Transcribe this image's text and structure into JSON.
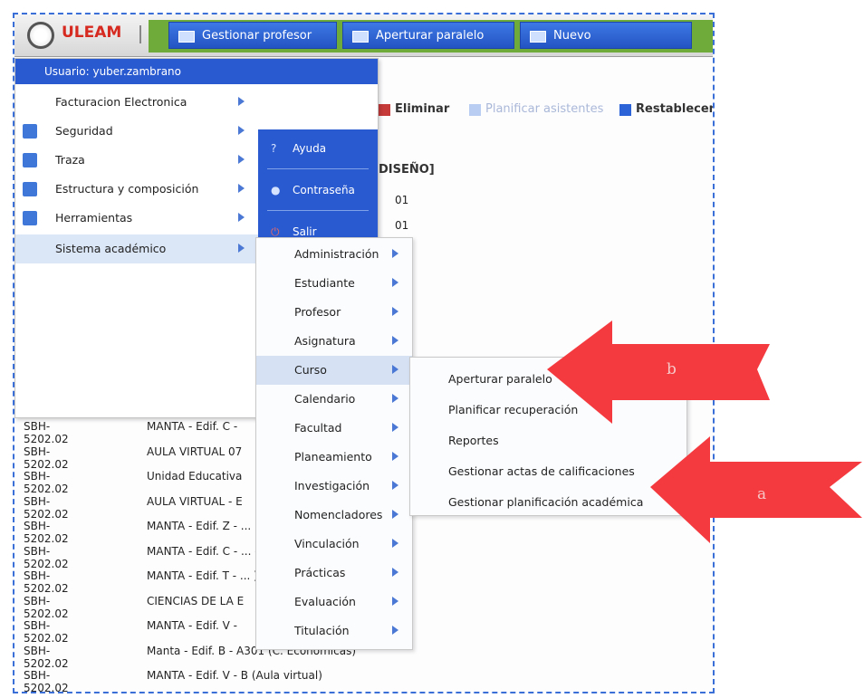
{
  "header": {
    "brand": "ULEAM",
    "nav": [
      "Gestionar profesor",
      "Aperturar paralelo",
      "Nuevo"
    ]
  },
  "toolbar": {
    "delete": "Eliminar",
    "disabled": "Planificar asistentes",
    "restore": "Restablecer"
  },
  "background": {
    "title": "DISEÑO]",
    "mini_rows": [
      "01",
      "01"
    ],
    "rows": [
      {
        "code": "SBH-5202.02",
        "place": "MANTA - Edif. C -"
      },
      {
        "code": "SBH-5202.02",
        "place": "AULA VIRTUAL 07"
      },
      {
        "code": "SBH-5202.02",
        "place": "Unidad Educativa"
      },
      {
        "code": "SBH-5202.02",
        "place": "AULA VIRTUAL - E"
      },
      {
        "code": "SBH-5202.02",
        "place": "MANTA - Edif. Z - ... la Educación)"
      },
      {
        "code": "SBH-5202.02",
        "place": "MANTA - Edif. C - ... conómicas)"
      },
      {
        "code": "SBH-5202.02",
        "place": "MANTA - Edif. T - ... )"
      },
      {
        "code": "SBH-5202.02",
        "place": "CIENCIAS DE LA E"
      },
      {
        "code": "SBH-5202.02",
        "place": "MANTA - Edif. V -"
      },
      {
        "code": "SBH-5202.02",
        "place": "Manta - Edif. B - A301 (C. Económicas)"
      },
      {
        "code": "SBH-5202.02",
        "place": "MANTA - Edif. V - B (Aula virtual)"
      }
    ]
  },
  "user_menu": {
    "user": "Usuario: yuber.zambrano",
    "items": [
      "Facturacion Electronica",
      "Seguridad",
      "Traza",
      "Estructura y composición",
      "Herramientas",
      "Sistema académico"
    ],
    "side": [
      "Ayuda",
      "Contraseña",
      "Salir"
    ]
  },
  "submenu": {
    "items": [
      "Administración",
      "Estudiante",
      "Profesor",
      "Asignatura",
      "Curso",
      "Calendario",
      "Facultad",
      "Planeamiento",
      "Investigación",
      "Nomencladores",
      "Vinculación",
      "Prácticas",
      "Evaluación",
      "Titulación"
    ]
  },
  "curso_menu": {
    "items": [
      "Aperturar paralelo",
      "Planificar recuperación",
      "Reportes",
      "Gestionar actas de calificaciones",
      "Gestionar planificación académica"
    ]
  },
  "annotations": {
    "arrow_b": "b",
    "arrow_a": "a",
    "color": "#f43a3f"
  }
}
